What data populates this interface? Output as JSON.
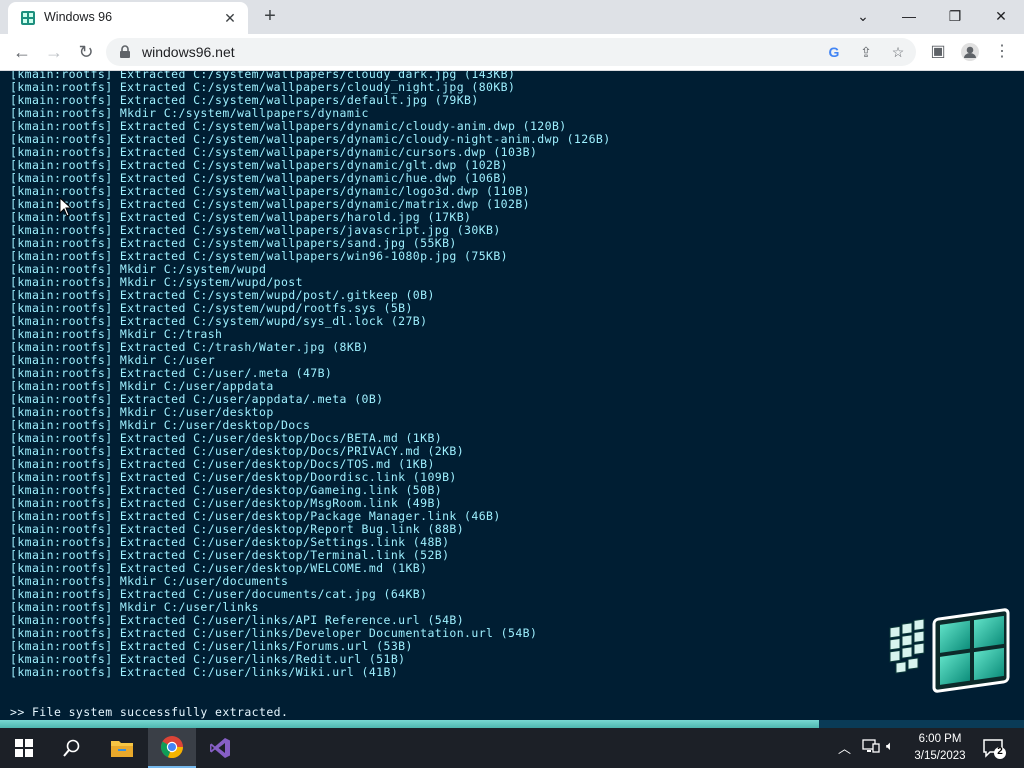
{
  "browser": {
    "tab_title": "Windows 96",
    "url": "windows96.net"
  },
  "terminal": {
    "lines": [
      "[kmain:rootfs] Extracted C:/system/wallpapers/cloudy_dark.jpg (143KB)",
      "[kmain:rootfs] Extracted C:/system/wallpapers/cloudy_night.jpg (80KB)",
      "[kmain:rootfs] Extracted C:/system/wallpapers/default.jpg (79KB)",
      "[kmain:rootfs] Mkdir C:/system/wallpapers/dynamic",
      "[kmain:rootfs] Extracted C:/system/wallpapers/dynamic/cloudy-anim.dwp (120B)",
      "[kmain:rootfs] Extracted C:/system/wallpapers/dynamic/cloudy-night-anim.dwp (126B)",
      "[kmain:rootfs] Extracted C:/system/wallpapers/dynamic/cursors.dwp (103B)",
      "[kmain:rootfs] Extracted C:/system/wallpapers/dynamic/glt.dwp (102B)",
      "[kmain:rootfs] Extracted C:/system/wallpapers/dynamic/hue.dwp (106B)",
      "[kmain:rootfs] Extracted C:/system/wallpapers/dynamic/logo3d.dwp (110B)",
      "[kmain:rootfs] Extracted C:/system/wallpapers/dynamic/matrix.dwp (102B)",
      "[kmain:rootfs] Extracted C:/system/wallpapers/harold.jpg (17KB)",
      "[kmain:rootfs] Extracted C:/system/wallpapers/javascript.jpg (30KB)",
      "[kmain:rootfs] Extracted C:/system/wallpapers/sand.jpg (55KB)",
      "[kmain:rootfs] Extracted C:/system/wallpapers/win96-1080p.jpg (75KB)",
      "[kmain:rootfs] Mkdir C:/system/wupd",
      "[kmain:rootfs] Mkdir C:/system/wupd/post",
      "[kmain:rootfs] Extracted C:/system/wupd/post/.gitkeep (0B)",
      "[kmain:rootfs] Extracted C:/system/wupd/rootfs.sys (5B)",
      "[kmain:rootfs] Extracted C:/system/wupd/sys_dl.lock (27B)",
      "[kmain:rootfs] Mkdir C:/trash",
      "[kmain:rootfs] Extracted C:/trash/Water.jpg (8KB)",
      "[kmain:rootfs] Mkdir C:/user",
      "[kmain:rootfs] Extracted C:/user/.meta (47B)",
      "[kmain:rootfs] Mkdir C:/user/appdata",
      "[kmain:rootfs] Extracted C:/user/appdata/.meta (0B)",
      "[kmain:rootfs] Mkdir C:/user/desktop",
      "[kmain:rootfs] Mkdir C:/user/desktop/Docs",
      "[kmain:rootfs] Extracted C:/user/desktop/Docs/BETA.md (1KB)",
      "[kmain:rootfs] Extracted C:/user/desktop/Docs/PRIVACY.md (2KB)",
      "[kmain:rootfs] Extracted C:/user/desktop/Docs/TOS.md (1KB)",
      "[kmain:rootfs] Extracted C:/user/desktop/Doordisc.link (109B)",
      "[kmain:rootfs] Extracted C:/user/desktop/Gameing.link (50B)",
      "[kmain:rootfs] Extracted C:/user/desktop/MsgRoom.link (49B)",
      "[kmain:rootfs] Extracted C:/user/desktop/Package Manager.link (46B)",
      "[kmain:rootfs] Extracted C:/user/desktop/Report Bug.link (88B)",
      "[kmain:rootfs] Extracted C:/user/desktop/Settings.link (48B)",
      "[kmain:rootfs] Extracted C:/user/desktop/Terminal.link (52B)",
      "[kmain:rootfs] Extracted C:/user/desktop/WELCOME.md (1KB)",
      "[kmain:rootfs] Mkdir C:/user/documents",
      "[kmain:rootfs] Extracted C:/user/documents/cat.jpg (64KB)",
      "[kmain:rootfs] Mkdir C:/user/links",
      "[kmain:rootfs] Extracted C:/user/links/API Reference.url (54B)",
      "[kmain:rootfs] Extracted C:/user/links/Developer Documentation.url (54B)",
      "[kmain:rootfs] Extracted C:/user/links/Forums.url (53B)",
      "[kmain:rootfs] Extracted C:/user/links/Redit.url (51B)",
      "[kmain:rootfs] Extracted C:/user/links/Wiki.url (41B)"
    ],
    "prompt_text": ">> File system successfully extracted.",
    "progress_fraction": 0.8
  },
  "taskbar": {
    "time": "6:00 PM",
    "date": "3/15/2023",
    "notification_count": "2",
    "apps": [
      "start-icon",
      "search-icon",
      "file-explorer-icon",
      "chrome-icon",
      "visual-studio-icon"
    ]
  },
  "colors": {
    "terminal_bg": "#001e33",
    "terminal_text": "#9ef0ff",
    "progress_fill": "#6fd0c9"
  }
}
